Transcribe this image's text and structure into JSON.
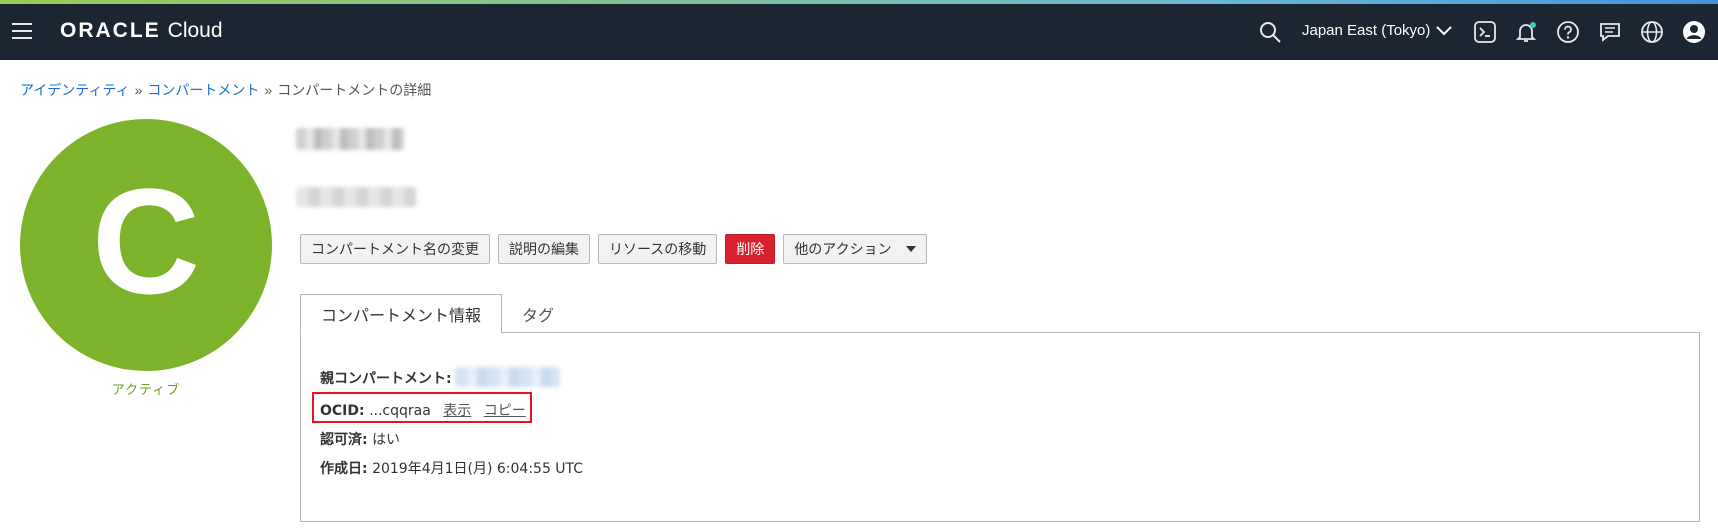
{
  "header": {
    "brand_oracle": "ORACLE",
    "brand_cloud": "Cloud",
    "region": "Japan East (Tokyo)"
  },
  "breadcrumb": {
    "items": [
      "アイデンティティ",
      "コンパートメント"
    ],
    "separator": "»",
    "current": "コンパートメントの詳細"
  },
  "avatar": {
    "letter": "C",
    "color": "#7cb32a",
    "status": "アクティブ"
  },
  "actions": {
    "rename": "コンパートメント名の変更",
    "edit_description": "説明の編集",
    "move_resource": "リソースの移動",
    "delete": "削除",
    "more_actions": "他のアクション"
  },
  "tabs": {
    "info": "コンパートメント情報",
    "tags": "タグ"
  },
  "details": {
    "parent_label": "親コンパートメント:",
    "ocid_label": "OCID:",
    "ocid_value": "...cqqraa",
    "ocid_show": "表示",
    "ocid_copy": "コピー",
    "authorized_label": "認可済:",
    "authorized_value": "はい",
    "created_label": "作成日:",
    "created_value": "2019年4月1日(月) 6:04:55 UTC"
  },
  "colors": {
    "topbar": "#1c2633",
    "link": "#1a73c8",
    "delete": "#d9202e",
    "highlight": "#e8131e"
  },
  "icons": [
    "menu-icon",
    "search-icon",
    "chevron-down-icon",
    "cloud-shell-icon",
    "bell-icon",
    "help-icon",
    "chat-icon",
    "globe-icon",
    "user-icon"
  ]
}
